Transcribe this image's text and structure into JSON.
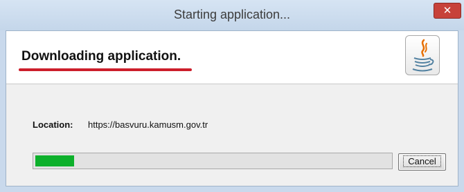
{
  "window": {
    "title": "Starting application...",
    "close_label": "✕"
  },
  "header": {
    "title": "Downloading application.",
    "icon": "java-logo-icon",
    "underline_color": "#cc1e2b"
  },
  "location": {
    "label": "Location:",
    "value": "https://basvuru.kamusm.gov.tr"
  },
  "progress": {
    "value_fraction": 0.11,
    "color": "#0db02b"
  },
  "buttons": {
    "cancel_label": "Cancel"
  }
}
